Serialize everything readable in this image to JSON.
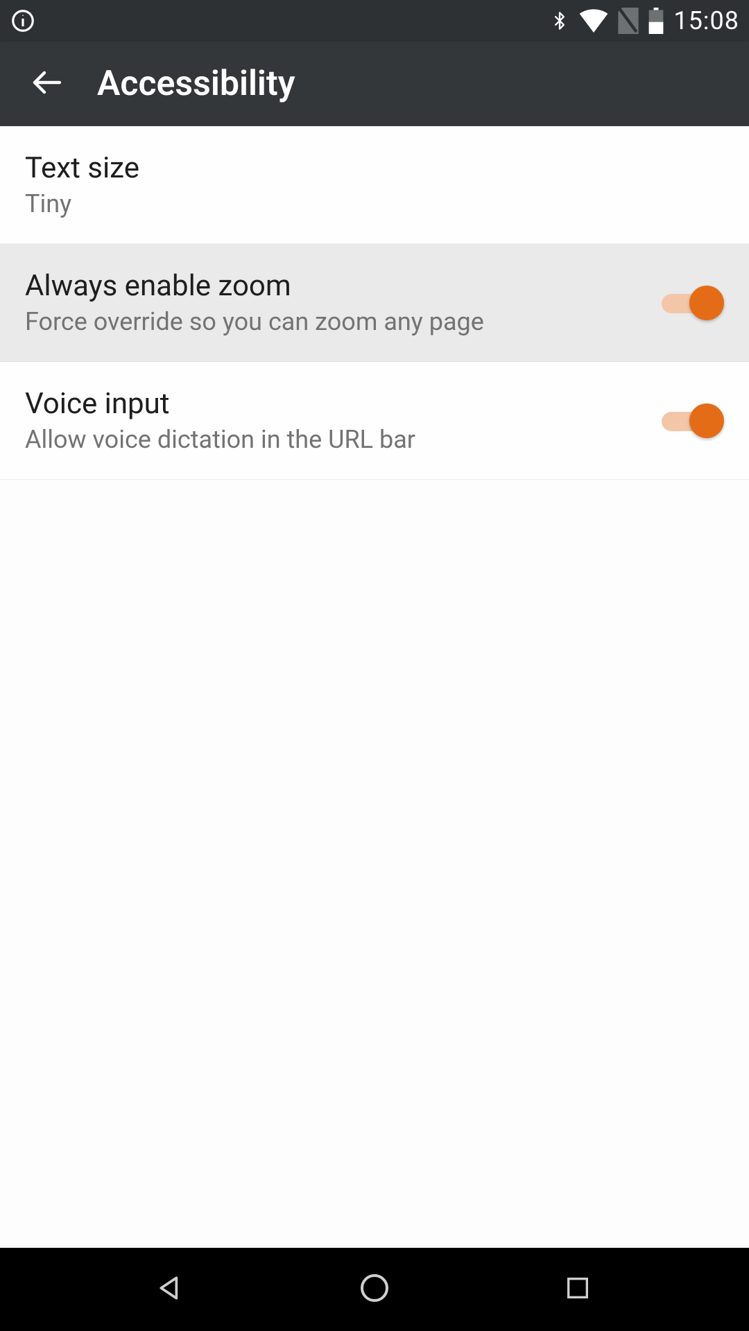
{
  "status_bar": {
    "time": "15:08"
  },
  "app_bar": {
    "title": "Accessibility"
  },
  "settings": {
    "text_size": {
      "title": "Text size",
      "value": "Tiny"
    },
    "always_zoom": {
      "title": "Always enable zoom",
      "subtitle": "Force override so you can zoom any page",
      "enabled": true
    },
    "voice_input": {
      "title": "Voice input",
      "subtitle": "Allow voice dictation in the URL bar",
      "enabled": true
    }
  },
  "colors": {
    "accent": "#e56c17",
    "accent_track": "#f3c6a8",
    "app_bar_bg": "#333739",
    "status_bar_bg": "#2e3134"
  }
}
